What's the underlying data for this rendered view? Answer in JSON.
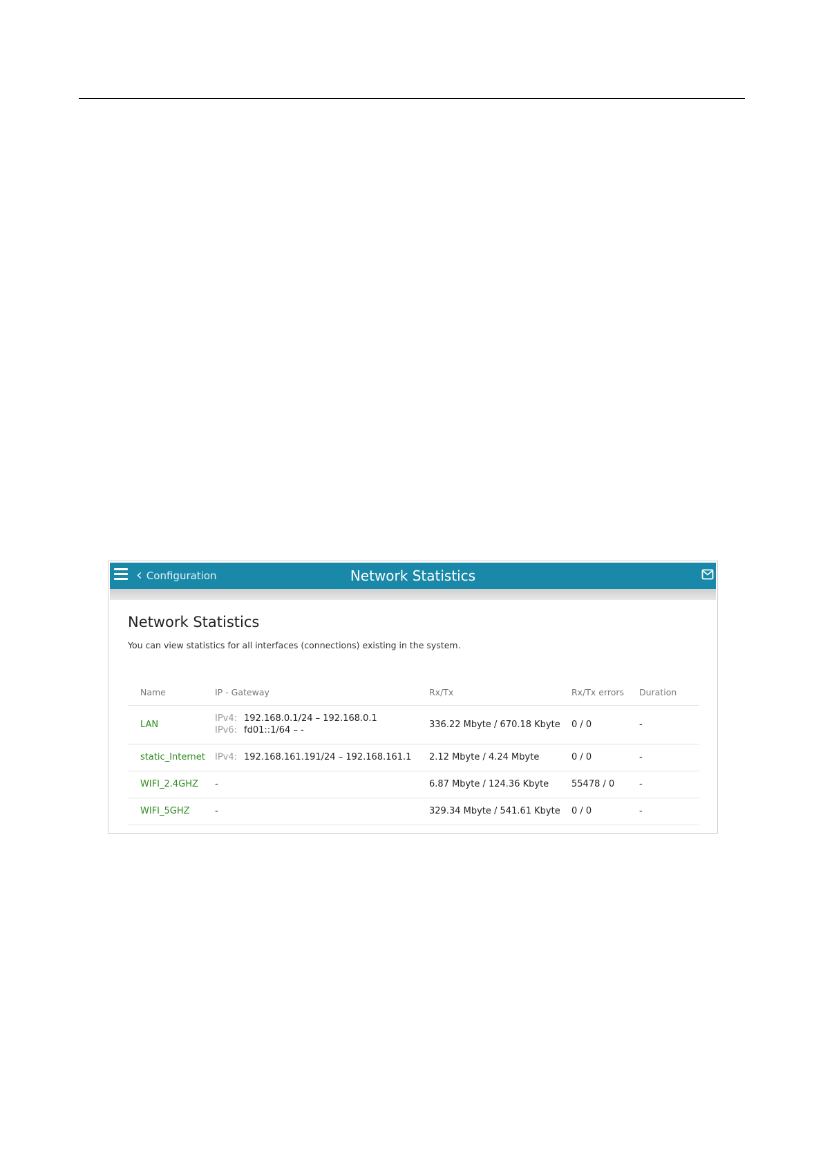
{
  "header": {
    "menu_icon": "hamburger-menu-icon",
    "back_label": "Configuration",
    "title": "Network Statistics",
    "mail_icon": "envelope-icon",
    "accent_color": "#1a88a8"
  },
  "main": {
    "heading": "Network Statistics",
    "description": "You can view statistics for all interfaces (connections) existing in the system."
  },
  "table": {
    "columns": [
      "Name",
      "IP - Gateway",
      "Rx/Tx",
      "Rx/Tx errors",
      "Duration"
    ],
    "rows": [
      {
        "name": "LAN",
        "ipv4_label": "IPv4:",
        "ipv4": "192.168.0.1/24 – 192.168.0.1",
        "ipv6_label": "IPv6:",
        "ipv6": "fd01::1/64 –  -",
        "rxtx": "336.22 Mbyte / 670.18 Kbyte",
        "errors": "0 / 0",
        "duration": "-"
      },
      {
        "name": "static_Internet",
        "ipv4_label": "IPv4:",
        "ipv4": "192.168.161.191/24 – 192.168.161.1",
        "rxtx": "2.12 Mbyte / 4.24 Mbyte",
        "errors": "0 / 0",
        "duration": "-"
      },
      {
        "name": "WIFI_2.4GHZ",
        "gateway": "-",
        "rxtx": "6.87 Mbyte / 124.36 Kbyte",
        "errors": "55478 / 0",
        "duration": "-"
      },
      {
        "name": "WIFI_5GHZ",
        "gateway": "-",
        "rxtx": "329.34 Mbyte / 541.61 Kbyte",
        "errors": "0 / 0",
        "duration": "-"
      }
    ]
  }
}
